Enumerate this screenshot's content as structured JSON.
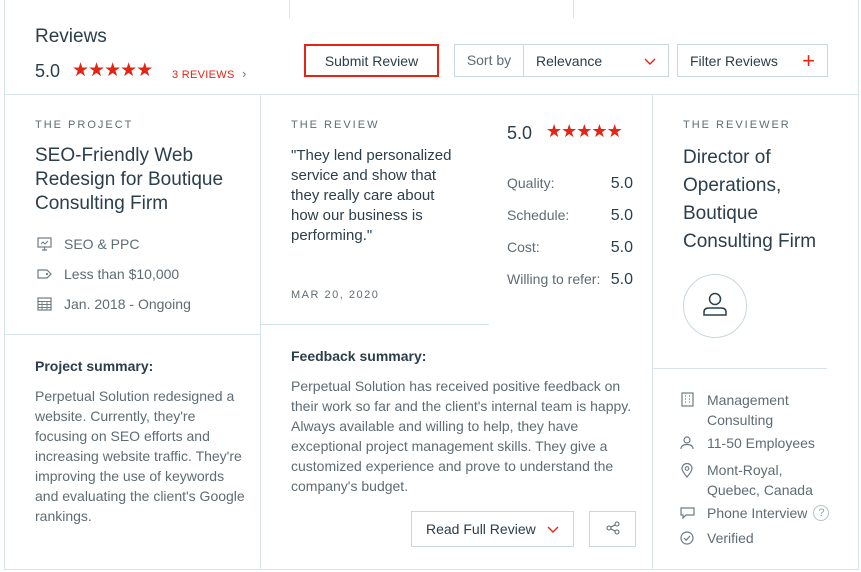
{
  "header": {
    "title": "Reviews",
    "rating": "5.0",
    "reviews_link": "3 REVIEWS",
    "chevron": "›",
    "submit_label": "Submit Review",
    "sort_label": "Sort by",
    "sort_value": "Relevance",
    "filter_label": "Filter Reviews",
    "filter_plus": "+"
  },
  "project": {
    "caps_title": "THE PROJECT",
    "name": "SEO-Friendly Web Redesign for Boutique Consulting Firm",
    "service": "SEO & PPC",
    "budget": "Less than $10,000",
    "dates": "Jan. 2018 - Ongoing",
    "summary_heading": "Project summary:",
    "summary": "Perpetual Solution redesigned a website. Currently, they're focusing on SEO efforts and increasing website traffic. They're improving the use of keywords and evaluating the client's Google rankings."
  },
  "review": {
    "caps_title": "THE REVIEW",
    "quote": "\"They lend personalized service and show that they really care about how our business is performing.\"",
    "date": "MAR 20, 2020",
    "overall": "5.0",
    "scores": [
      {
        "label": "Quality:",
        "value": "5.0"
      },
      {
        "label": "Schedule:",
        "value": "5.0"
      },
      {
        "label": "Cost:",
        "value": "5.0"
      },
      {
        "label": "Willing to refer:",
        "value": "5.0"
      }
    ],
    "feedback_heading": "Feedback summary:",
    "feedback": "Perpetual Solution has received positive feedback on their work so far and the client's internal team is happy. Always available and willing to help, they have exceptional project management skills. They give a customized experience and prove to understand the company's budget.",
    "read_full": "Read Full Review"
  },
  "reviewer": {
    "caps_title": "THE REVIEWER",
    "title": "Director of Operations, Boutique Consulting Firm",
    "industry": "Management Consulting",
    "size": "11-50 Employees",
    "location": "Mont-Royal, Quebec, Canada",
    "interview": "Phone Interview",
    "help": "?",
    "verified": "Verified"
  },
  "colors": {
    "accent": "#e62415",
    "border": "#d6e3ea",
    "text": "#2b3e4a"
  },
  "icons": [
    "star-icon",
    "chevron-right-icon",
    "chevron-down-icon",
    "plus-icon",
    "monitor-icon",
    "tag-icon",
    "calendar-icon",
    "share-icon",
    "user-icon",
    "building-icon",
    "people-icon",
    "location-pin-icon",
    "chat-icon",
    "help-icon",
    "check-circle-icon"
  ]
}
